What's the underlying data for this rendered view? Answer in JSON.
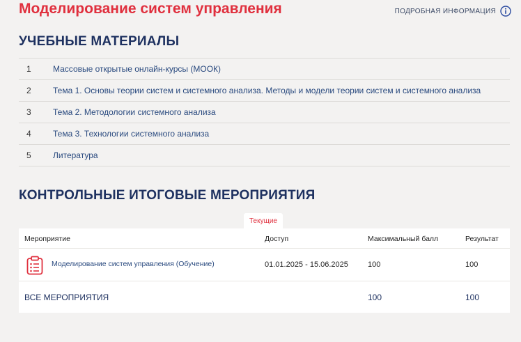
{
  "header": {
    "course_title": "Моделирование систем управления",
    "info_link": "ПОДРОБНАЯ ИНФОРМАЦИЯ",
    "info_icon": "info-circle-icon"
  },
  "materials": {
    "title": "УЧЕБНЫЕ МАТЕРИАЛЫ",
    "items": [
      {
        "num": "1",
        "label": "Массовые открытые онлайн-курсы (МООК)"
      },
      {
        "num": "2",
        "label": "Тема 1. Основы теории систем и системного анализа. Методы и модели теории систем и системного анализа"
      },
      {
        "num": "3",
        "label": "Тема 2. Методологии системного анализа"
      },
      {
        "num": "4",
        "label": "Тема 3. Технологии системного анализа"
      },
      {
        "num": "5",
        "label": "Литература"
      }
    ]
  },
  "events": {
    "title": "КОНТРОЛЬНЫЕ ИТОГОВЫЕ МЕРОПРИЯТИЯ",
    "tab": "Текущие",
    "columns": [
      "Мероприятие",
      "Доступ",
      "Максимальный балл",
      "Результат"
    ],
    "rows": [
      {
        "name": "Моделирование систем управления (Обучение)",
        "access": "01.01.2025 - 15.06.2025",
        "max": "100",
        "result": "100",
        "icon": "clipboard-task-icon"
      }
    ],
    "total": {
      "label": "ВСЕ МЕРОПРИЯТИЯ",
      "max": "100",
      "result": "100"
    }
  },
  "colors": {
    "accent": "#e0303e",
    "heading": "#1e3160",
    "link": "#2a4a7f",
    "background": "#f3f2f1"
  }
}
